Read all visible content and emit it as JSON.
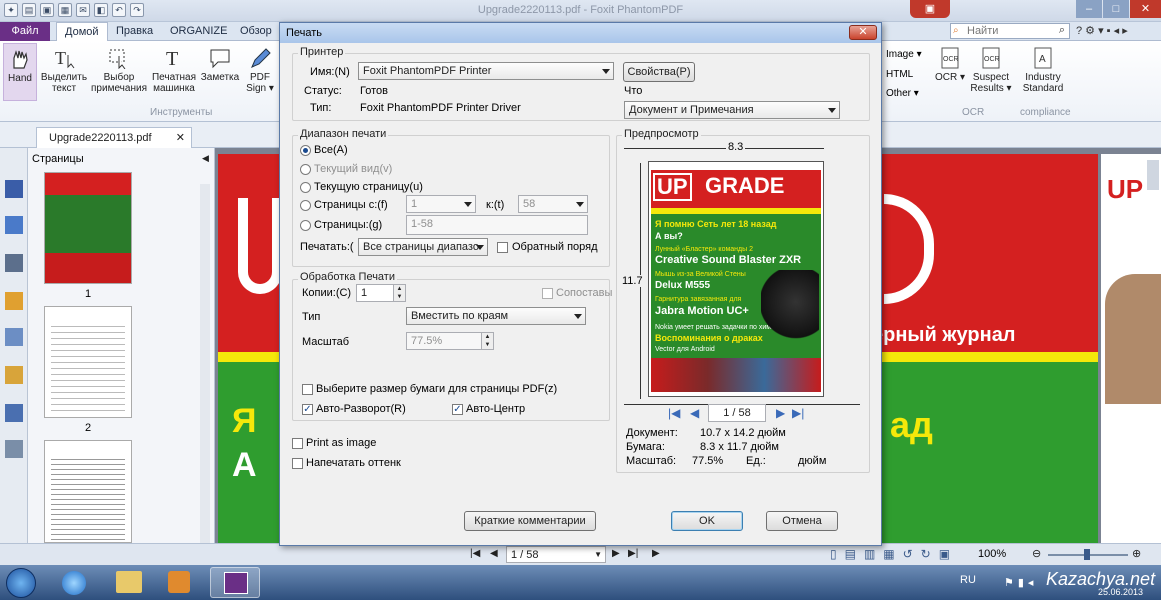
{
  "window": {
    "title": "Upgrade2220113.pdf - Foxit PhantomPDF"
  },
  "ribbon_tabs": [
    "Файл",
    "Домой",
    "Правка",
    "ORGANIZE",
    "Обзор"
  ],
  "ribbon": {
    "buttons": [
      {
        "label": "Hand"
      },
      {
        "label": "Выделить текст"
      },
      {
        "label": "Выбор примечания"
      },
      {
        "label": "Печатная машинка"
      },
      {
        "label": "Заметка"
      },
      {
        "label": "PDF Sign ▾"
      }
    ],
    "group_tools": "Инструменты",
    "right_items": [
      "Image ▾",
      "HTML",
      "Other ▾"
    ],
    "ocr": {
      "label": "OCR ▾",
      "suspect": "Suspect Results ▾",
      "group": "OCR"
    },
    "industry": {
      "label": "Industry Standard",
      "group": "compliance"
    },
    "search_placeholder": "Найти"
  },
  "doc_tab": "Upgrade2220113.pdf",
  "thumb_pane": {
    "title": "Страницы",
    "page_labels": [
      "1",
      "2"
    ]
  },
  "dialog": {
    "title": "Печать",
    "printer": {
      "group": "Принтер",
      "name_label": "Имя:(N)",
      "name_value": "Foxit PhantomPDF Printer",
      "props_button": "Свойства(P)",
      "status_label": "Статус:",
      "status_value": "Готов",
      "type_label": "Тип:",
      "type_value": "Foxit PhantomPDF Printer Driver",
      "what_label": "Что",
      "what_value": "Документ и Примечания"
    },
    "range": {
      "group": "Диапазон печати",
      "all": "Все(A)",
      "current_view": "Текущий вид(v)",
      "current_page": "Текущую страницу(u)",
      "pages_from": "Страницы с:(f)",
      "from_value": "1",
      "to_label": "к:(t)",
      "to_value": "58",
      "pages": "Страницы:(g)",
      "pages_value": "1-58",
      "print_label": "Печатать:(",
      "print_value": "Все страницы диапазо",
      "reverse": "Обратный поряд"
    },
    "handling": {
      "group": "Обработка Печати",
      "copies_label": "Копии:(C)",
      "copies_value": "1",
      "collate": "Сопоставы",
      "type_label": "Тип",
      "type_value": "Вместить по краям",
      "scale_label": "Масштаб",
      "scale_value": "77.5%",
      "paper_size": "Выберите размер бумаги для страницы PDF(z)",
      "auto_rotate": "Авто-Разворот(R)",
      "auto_center": "Авто-Центр"
    },
    "print_as_image": "Print as image",
    "print_shade": "Напечатать оттенк",
    "preview": {
      "group": "Предпросмотр",
      "width": "8.3",
      "height": "11.7",
      "page_nav": "1 / 58",
      "doc_label": "Документ:",
      "doc_value": "10.7 x 14.2 дюйм",
      "paper_label": "Бумага:",
      "paper_value": "8.3 x 11.7 дюйм",
      "scale_label": "Масштаб:",
      "scale_value": "77.5%",
      "units_label": "Ед.:",
      "units_value": "дюйм"
    },
    "summary_button": "Краткие комментарии",
    "ok_button": "OK",
    "cancel_button": "Отмена"
  },
  "magazine": {
    "brand_up": "UP",
    "brand_grade": "GRADE",
    "lines": [
      "Я помню Сеть лет 18 назад",
      "А вы?",
      "Лунный «Бластер» команды 2",
      "Creative Sound Blaster ZXR",
      "Мышь из-за Великой Стены",
      "Delux M555",
      "Гарнитура завязанная для",
      "Jabra Motion UC+",
      "Nokia умеет решать задачки по химии",
      "Воспоминания о драках",
      "Vector для Android"
    ]
  },
  "background_page": {
    "big_text": "ерный журнал",
    "letters": [
      "Я",
      "А"
    ],
    "right_letters": "ад",
    "corner": "UP"
  },
  "statusbar": {
    "page_nav": "1 / 58",
    "zoom": "100%"
  },
  "taskbar": {
    "lang": "RU",
    "watermark": "Kazachya.net",
    "date": "25.06.2013"
  }
}
